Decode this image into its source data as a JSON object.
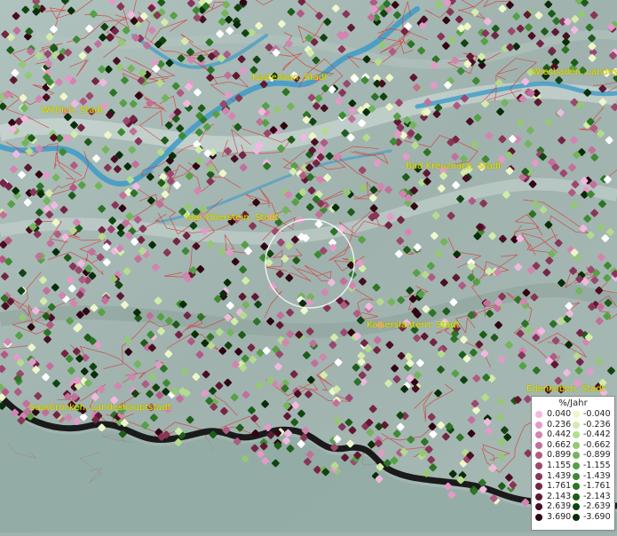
{
  "map": {
    "places": [
      {
        "name": "Kastellaun, Stadt"
      },
      {
        "name": "Wiesbaden, Landes"
      },
      {
        "name": "Wittlich, Stadt"
      },
      {
        "name": "Bad Kreuznach, Stadt"
      },
      {
        "name": "Idar-Oberstein, Stadt"
      },
      {
        "name": "Kaiserslautern, Stadt"
      },
      {
        "name": "Saarbrücken, Landeshauptstadt"
      },
      {
        "name": "Edenkoben, Stadt"
      }
    ],
    "colors": {
      "terrain": "#9fb2ad",
      "water": "#3d9ac8",
      "boundaries": "#d63a3a",
      "label_text": "#e8e600",
      "dark_band": "#1a1a1a"
    }
  },
  "legend": {
    "unit": "%/Jahr",
    "positive": [
      {
        "value": "0.040",
        "color": "#f2b8e0"
      },
      {
        "value": "0.236",
        "color": "#e49ac8"
      },
      {
        "value": "0.442",
        "color": "#d484b0"
      },
      {
        "value": "0.662",
        "color": "#c2709a"
      },
      {
        "value": "0.899",
        "color": "#b05a84"
      },
      {
        "value": "1.155",
        "color": "#9c476e"
      },
      {
        "value": "1.439",
        "color": "#883558"
      },
      {
        "value": "1.761",
        "color": "#742544"
      },
      {
        "value": "2.143",
        "color": "#601832"
      },
      {
        "value": "2.639",
        "color": "#4a0e22"
      },
      {
        "value": "3.690",
        "color": "#300612"
      }
    ],
    "negative": [
      {
        "value": "-0.040",
        "color": "#eef7c8"
      },
      {
        "value": "-0.236",
        "color": "#d4ecaa"
      },
      {
        "value": "-0.442",
        "color": "#b4dc8c"
      },
      {
        "value": "-0.662",
        "color": "#94c874"
      },
      {
        "value": "-0.899",
        "color": "#74b45c"
      },
      {
        "value": "-1.155",
        "color": "#56a046"
      },
      {
        "value": "-1.439",
        "color": "#3e8a34"
      },
      {
        "value": "-1.761",
        "color": "#2c7426"
      },
      {
        "value": "-2.143",
        "color": "#1e5c1a"
      },
      {
        "value": "-2.639",
        "color": "#124412"
      },
      {
        "value": "-3.690",
        "color": "#082e08"
      }
    ]
  }
}
